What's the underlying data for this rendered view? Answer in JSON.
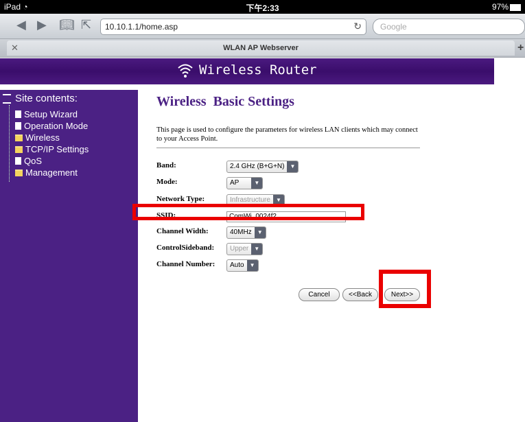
{
  "status_bar": {
    "device": "iPad",
    "time": "下午2:33",
    "battery": "97%"
  },
  "browser": {
    "url": "10.10.1.1/home.asp",
    "search_placeholder": "Google",
    "tab_title": "WLAN AP Webserver",
    "icons": [
      "back-icon",
      "forward-icon",
      "bookmarks-icon",
      "share-icon",
      "reload-icon",
      "close-icon",
      "new-tab-icon"
    ]
  },
  "header": {
    "brand": "Wireless Router"
  },
  "sidebar": {
    "title": "Site contents:",
    "items": [
      {
        "label": "Setup Wizard",
        "icon": "page"
      },
      {
        "label": "Operation Mode",
        "icon": "page"
      },
      {
        "label": "Wireless",
        "icon": "folder"
      },
      {
        "label": "TCP/IP Settings",
        "icon": "folder"
      },
      {
        "label": "QoS",
        "icon": "page"
      },
      {
        "label": "Management",
        "icon": "folder"
      }
    ]
  },
  "main": {
    "title": "Wireless  Basic Settings",
    "description": "This page is used to configure the parameters for wireless LAN clients which may connect to your Access Point.",
    "fields": {
      "band": {
        "label": "Band:",
        "value": "2.4 GHz (B+G+N)"
      },
      "mode": {
        "label": "Mode:",
        "value": "AP"
      },
      "network_type": {
        "label": "Network Type:",
        "value": "Infrastructure"
      },
      "ssid": {
        "label": "SSID:",
        "value": "ComWi_0024f2"
      },
      "channel_width": {
        "label": "Channel Width:",
        "value": "40MHz"
      },
      "control_sideband": {
        "label": "ControlSideband:",
        "value": "Upper"
      },
      "channel_number": {
        "label": "Channel Number:",
        "value": "Auto"
      }
    },
    "buttons": {
      "cancel": "Cancel",
      "back": "<<Back",
      "next": "Next>>"
    }
  },
  "colors": {
    "brand": "#4b2184",
    "highlight": "#ea0000"
  }
}
